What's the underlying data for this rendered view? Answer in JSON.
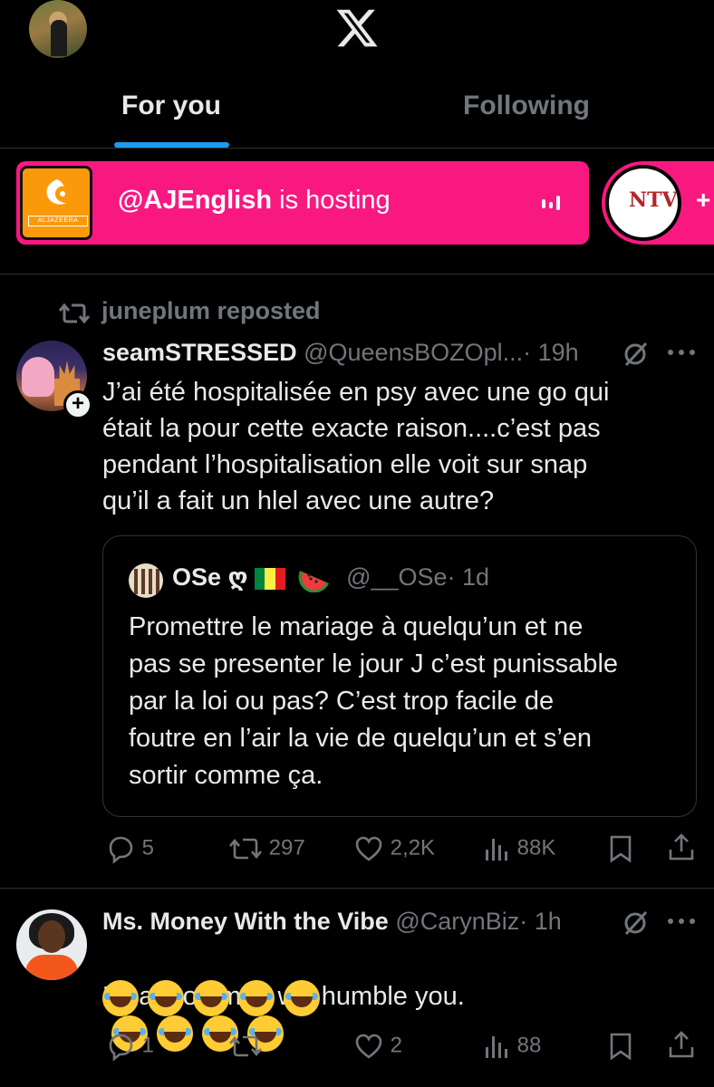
{
  "header": {
    "logo_icon": "x-logo-icon",
    "tabs": [
      {
        "label": "For you",
        "active": true
      },
      {
        "label": "Following",
        "active": false
      }
    ],
    "accent_color": "#1d9bf0"
  },
  "spaces": {
    "primary": {
      "host": "@AJEnglish",
      "status": " is hosting",
      "logo_text": "ALJAZEERA",
      "color": "#f91880"
    },
    "secondary": {
      "logo_text": "NTV",
      "more": "+"
    }
  },
  "posts": [
    {
      "repost_label": "juneplum reposted",
      "name": "seamSTRESSED",
      "handle": "@QueensBOZOpl...",
      "time": "· 19h",
      "text": "J’ai été hospitalisée en psy avec une go qui\nétait la pour cette exacte raison....c’est pas\npendant l’hospitalisation elle voit sur snap\nqu’il a fait un hlel avec une autre?",
      "quote": {
        "name": "OSe ღ",
        "handle": "@__OSe",
        "time": "· 1d",
        "text": "Promettre le mariage à quelqu’un et ne\npas se presenter le jour J c’est punissable\npar la loi ou pas? C’est trop facile de\nfoutre en l’air la vie de quelqu’un et s’en\nsortir comme ça."
      },
      "replies": "5",
      "reposts": "297",
      "likes": "2,2K",
      "views": "88K"
    },
    {
      "name": "Ms. Money With the Vibe",
      "handle": "@CarynBiz",
      "time": "· 1h",
      "text": "Lmaoooo men will humble you.",
      "replies": "1",
      "reposts": "",
      "likes": "2",
      "views": "88"
    }
  ]
}
